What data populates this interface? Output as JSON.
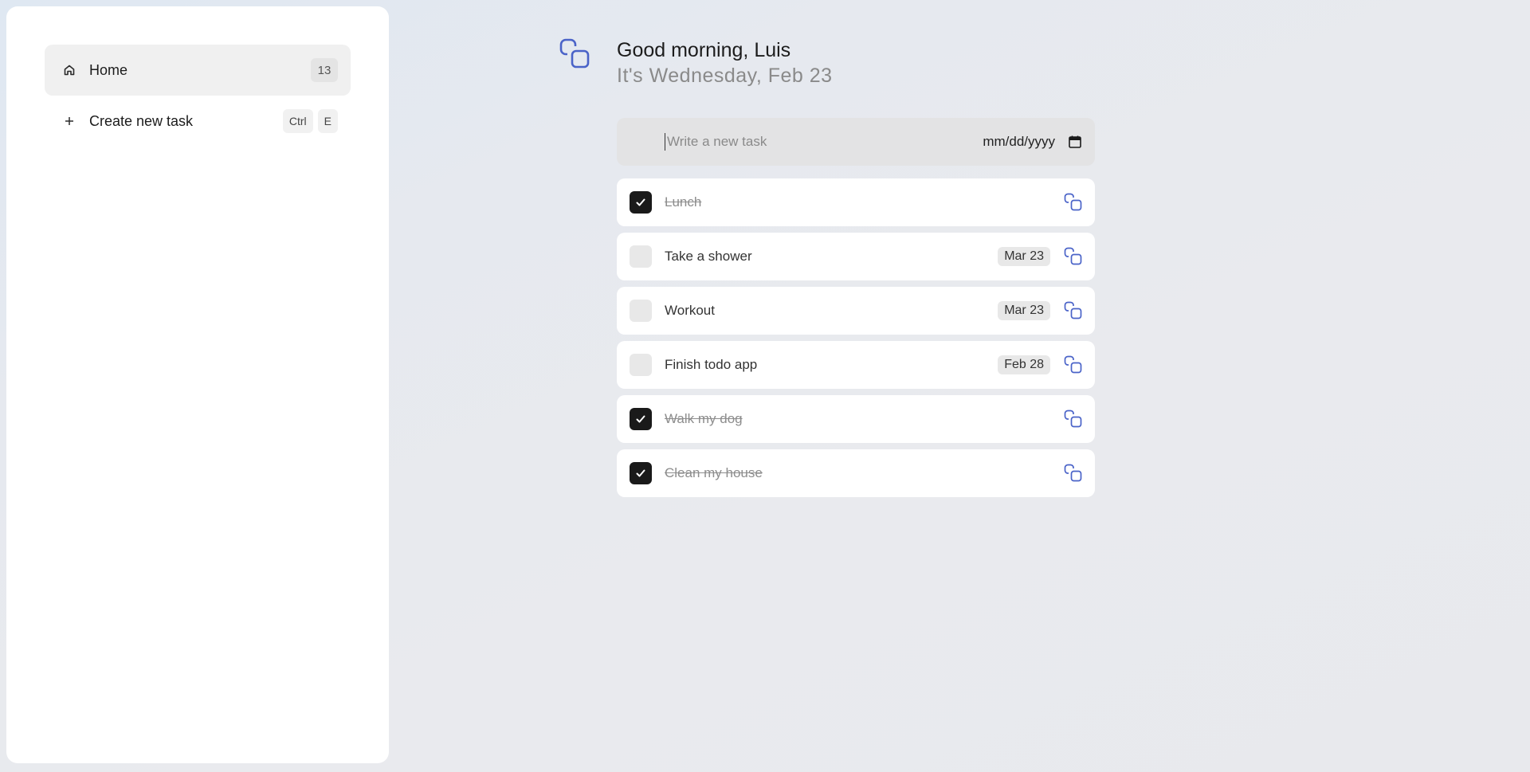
{
  "sidebar": {
    "home": {
      "label": "Home",
      "count": "13",
      "icon": "home-icon"
    },
    "create": {
      "label": "Create new task",
      "icon": "plus-icon",
      "shortcut": [
        "Ctrl",
        "E"
      ]
    }
  },
  "header": {
    "greeting": "Good morning, Luis",
    "date_line": "It's Wednesday, Feb 23",
    "logo_icon": "copy-squares-icon"
  },
  "new_task": {
    "placeholder": "Write a new task",
    "date_placeholder": "mm/dd/yyyy"
  },
  "tasks": [
    {
      "title": "Lunch",
      "done": true,
      "due": ""
    },
    {
      "title": "Take a shower",
      "done": false,
      "due": "Mar 23"
    },
    {
      "title": "Workout",
      "done": false,
      "due": "Mar 23"
    },
    {
      "title": "Finish todo app",
      "done": false,
      "due": "Feb 28"
    },
    {
      "title": "Walk my dog",
      "done": true,
      "due": ""
    },
    {
      "title": "Clean my house",
      "done": true,
      "due": ""
    }
  ],
  "colors": {
    "accent": "#4a63c8",
    "checked": "#1a1a1a"
  }
}
